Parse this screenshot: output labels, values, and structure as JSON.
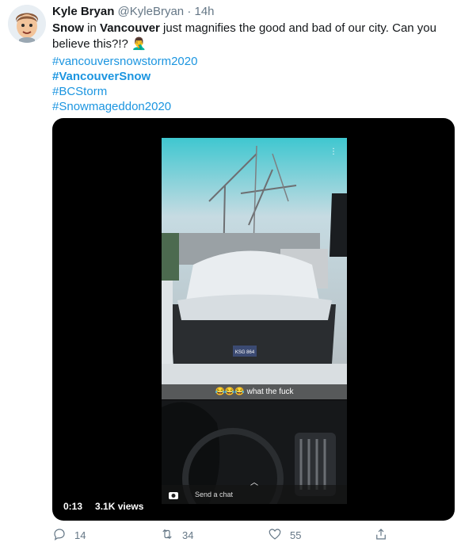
{
  "tweet": {
    "display_name": "Kyle Bryan",
    "handle": "@KyleBryan",
    "separator": "·",
    "time": "14h",
    "text_part1": "Snow",
    "text_part2": " in ",
    "text_part3": "Vancouver",
    "text_part4": " just magnifies the good and bad of our city. Can you believe this?!?",
    "emoji": "🤦‍♂️",
    "hashtags": [
      {
        "text": "#vancouversnowstorm2020",
        "bold": false
      },
      {
        "text": "#VancouverSnow",
        "bold": true
      },
      {
        "text": "#BCStorm",
        "bold": false
      },
      {
        "text": "#Snowmageddon2020",
        "bold": false
      }
    ]
  },
  "media": {
    "snap_caption_emojis": "😂😂😂",
    "snap_caption_text": "what the fuck",
    "snap_send_placeholder": "Send a chat",
    "plate_text": "KSG 864",
    "duration": "0:13",
    "views": "3.1K views"
  },
  "actions": {
    "reply_count": "14",
    "retweet_count": "34",
    "like_count": "55"
  },
  "colors": {
    "link": "#1b95e0",
    "muted": "#657786",
    "text": "#14171a"
  }
}
